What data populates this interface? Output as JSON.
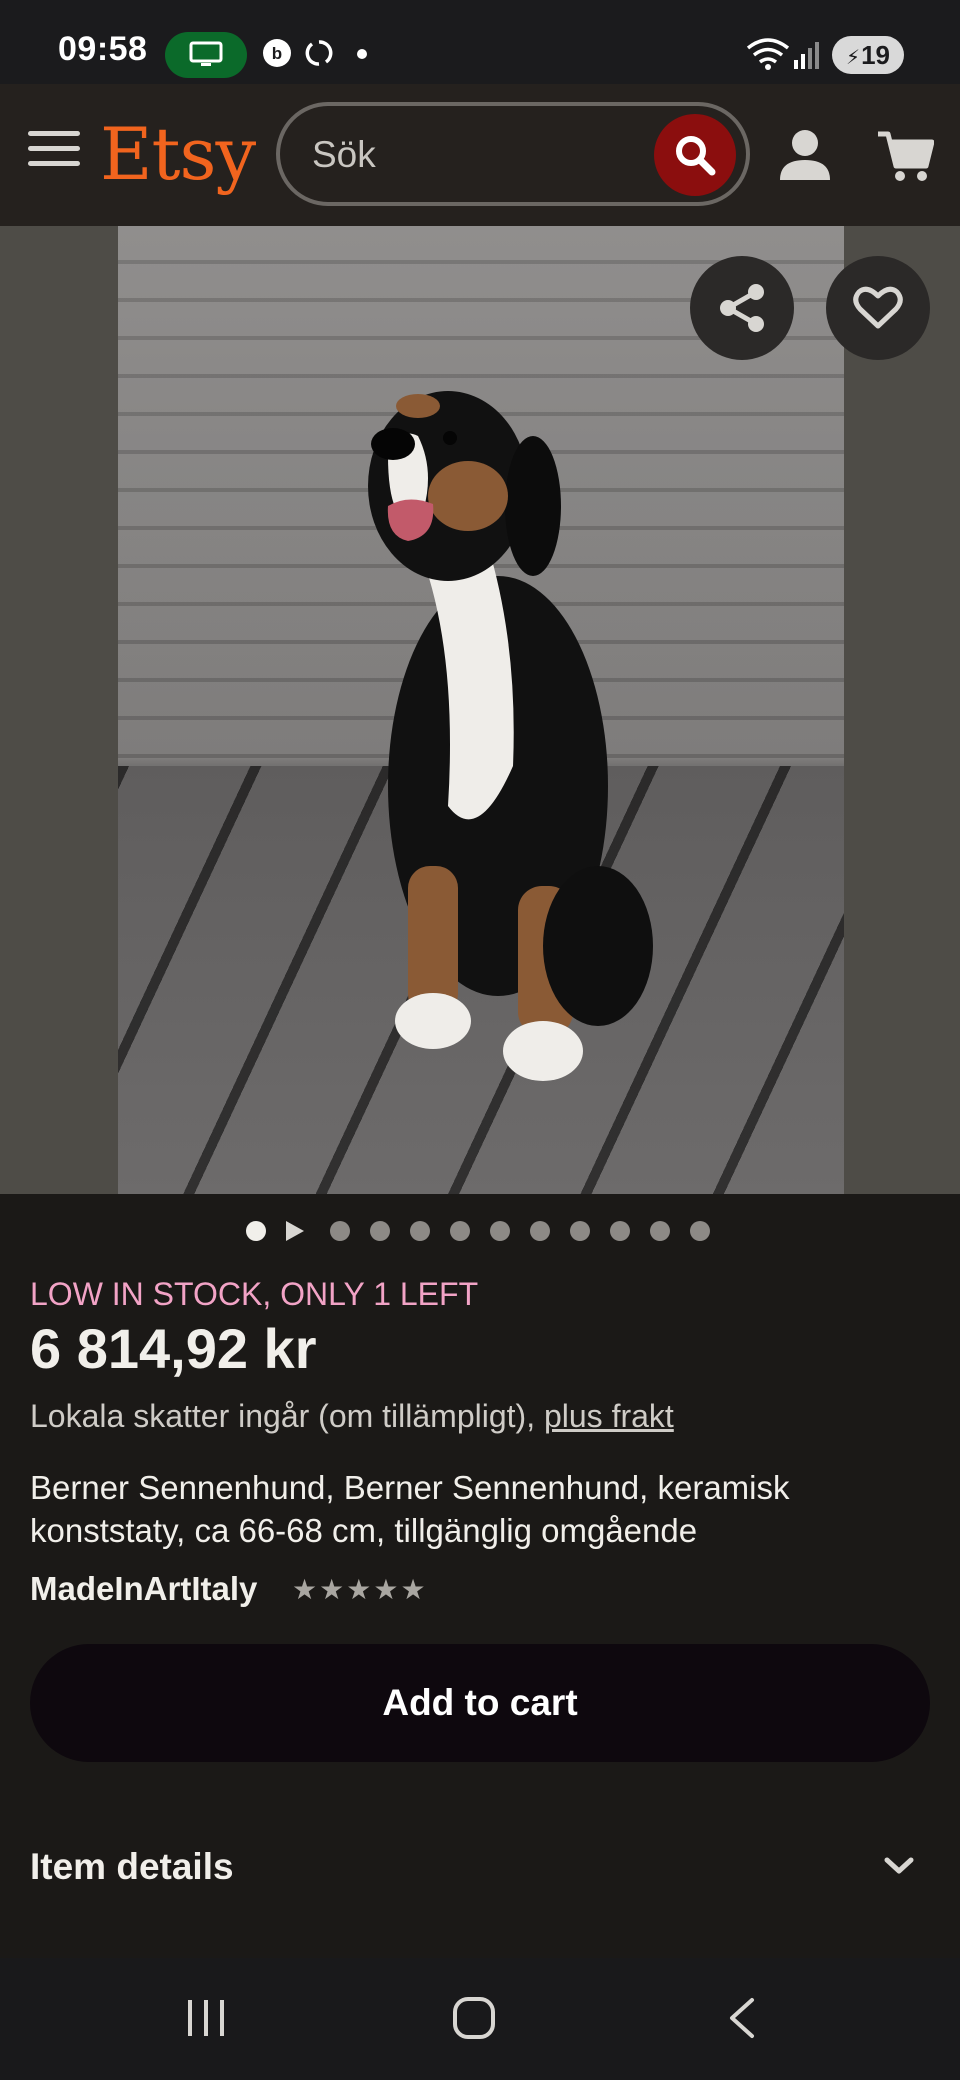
{
  "status_bar": {
    "time": "09:58",
    "battery": "19",
    "icons": [
      "screen-cast-icon",
      "b-app-icon",
      "sync-icon",
      "dot-icon",
      "wifi-icon",
      "signal-icon",
      "battery-charging-icon"
    ]
  },
  "header": {
    "logo": "Etsy",
    "search_placeholder": "Sök",
    "icons": [
      "menu-icon",
      "search-icon",
      "user-icon",
      "cart-icon"
    ]
  },
  "gallery": {
    "image_count": 12,
    "active_index": 0,
    "video_index": 1,
    "actions": [
      "share-icon",
      "heart-icon"
    ]
  },
  "product": {
    "stock_notice": "LOW IN STOCK, ONLY 1 LEFT",
    "price": "6 814,92 kr",
    "tax_text": "Lokala skatter ingår (om tillämpligt), ",
    "shipping_link": "plus frakt",
    "title": "Berner Sennenhund, Berner Sennenhund, keramisk konststaty, ca 66-68 cm, tillgänglig omgående",
    "shop_name": "MadeInArtItaly",
    "rating_stars": 5
  },
  "actions": {
    "add_to_cart": "Add to cart",
    "item_details": "Item details"
  },
  "colors": {
    "accent": "#f1641e",
    "stock": "#f2a3c6",
    "search_button": "#8b0e0e"
  }
}
